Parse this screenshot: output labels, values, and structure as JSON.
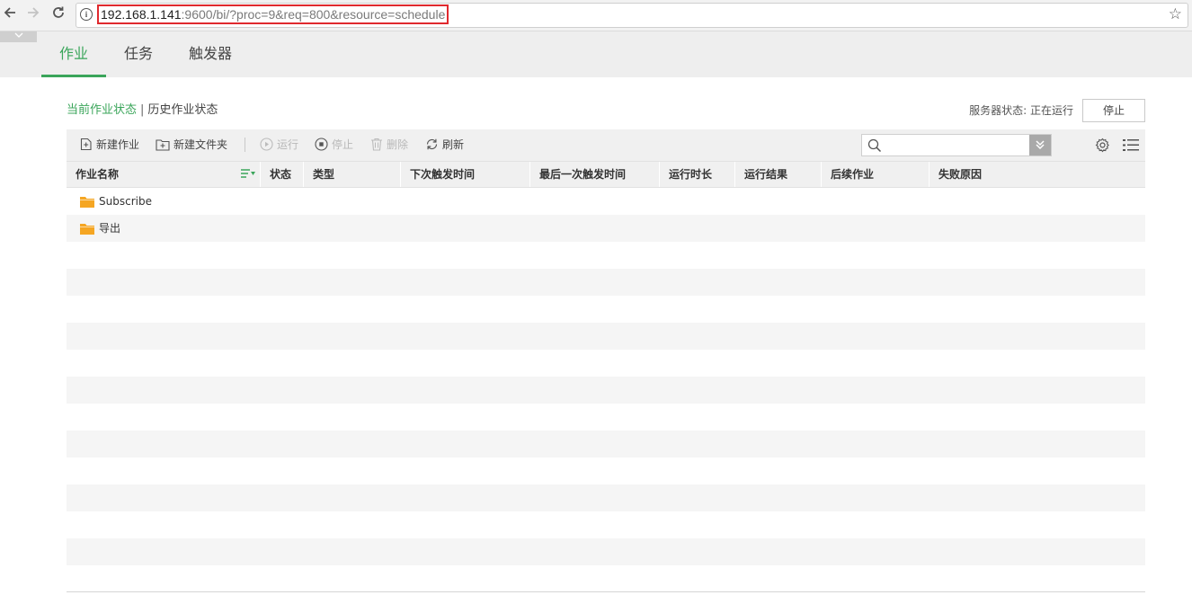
{
  "browser": {
    "url_host": "192.168.1.141",
    "url_rest": ":9600/bi/?proc=9&req=800&resource=schedule",
    "icons": [
      "back-arrow-icon",
      "forward-arrow-icon",
      "reload-icon",
      "info-icon",
      "star-icon"
    ]
  },
  "app": {
    "tabs": [
      {
        "label": "作业",
        "active": true
      },
      {
        "label": "任务",
        "active": false
      },
      {
        "label": "触发器",
        "active": false
      }
    ]
  },
  "status": {
    "current_link": "当前作业状态",
    "separator": "|",
    "history_link": "历史作业状态",
    "server_status_label": "服务器状态:",
    "server_status_value": "正在运行",
    "stop_button": "停止"
  },
  "toolbar": {
    "new_job": "新建作业",
    "new_folder": "新建文件夹",
    "run": "运行",
    "stop": "停止",
    "delete": "删除",
    "refresh": "刷新",
    "search_value": ""
  },
  "table": {
    "columns": [
      "作业名称",
      "状态",
      "类型",
      "下次触发时间",
      "最后一次触发时间",
      "运行时长",
      "运行结果",
      "后续作业",
      "失败原因"
    ],
    "rows": [
      {
        "name": "Subscribe",
        "type": "folder"
      },
      {
        "name": "导出",
        "type": "folder"
      }
    ]
  },
  "colors": {
    "accent": "#3aa55a",
    "folder": "#f5a623",
    "url_highlight_border": "#e0292e"
  }
}
